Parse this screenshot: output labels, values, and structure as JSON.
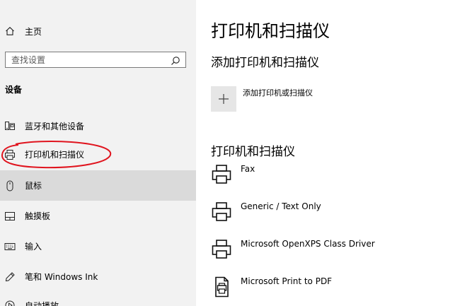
{
  "sidebar": {
    "home_label": "主页",
    "search_placeholder": "查找设置",
    "section_title": "设备",
    "items": [
      {
        "label": "蓝牙和其他设备",
        "icon": "bluetooth-devices-icon"
      },
      {
        "label": "打印机和扫描仪",
        "icon": "printer-icon"
      },
      {
        "label": "鼠标",
        "icon": "mouse-icon"
      },
      {
        "label": "触摸板",
        "icon": "touchpad-icon"
      },
      {
        "label": "输入",
        "icon": "keyboard-icon"
      },
      {
        "label": "笔和 Windows Ink",
        "icon": "pen-icon"
      },
      {
        "label": "自动播放",
        "icon": "autoplay-icon"
      }
    ],
    "selected_index": 2
  },
  "main": {
    "title": "打印机和扫描仪",
    "add_section_title": "添加打印机和扫描仪",
    "add_button_label": "添加打印机或扫描仪",
    "list_section_title": "打印机和扫描仪",
    "printers": [
      {
        "name": "Fax",
        "icon": "printer-icon"
      },
      {
        "name": "Generic / Text Only",
        "icon": "printer-icon"
      },
      {
        "name": "Microsoft OpenXPS Class Driver",
        "icon": "printer-icon"
      },
      {
        "name": "Microsoft Print to PDF",
        "icon": "pdf-printer-icon"
      }
    ]
  },
  "colors": {
    "sidebar_bg": "#f2f2f2",
    "selected_bg": "#dadada",
    "annotation_red": "#e0141e",
    "add_box_bg": "#e6e6e6"
  }
}
